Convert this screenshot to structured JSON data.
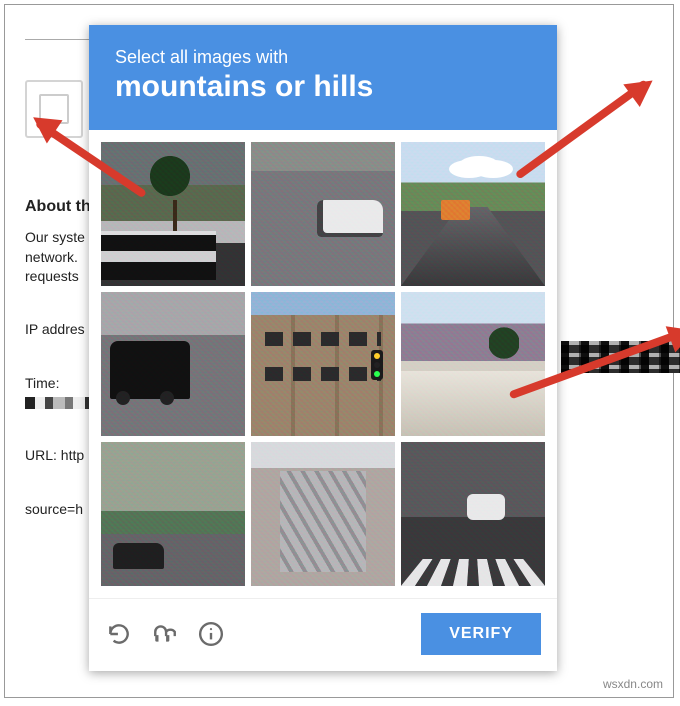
{
  "page": {
    "about_heading": "About th",
    "para1": "Our syste\nnetwork.\nrequests",
    "ip_label": "IP addres",
    "time_label": "Time:",
    "url_label": "URL: http",
    "source_label": "source=h"
  },
  "captcha": {
    "prompt_line1": "Select all images with",
    "prompt_target": "mountains or hills",
    "verify_label": "VERIFY",
    "tiles": [
      {
        "id": 1,
        "desc": "palm tree hills truck"
      },
      {
        "id": 2,
        "desc": "white car on road"
      },
      {
        "id": 3,
        "desc": "highway with hills and trucks"
      },
      {
        "id": 4,
        "desc": "black SUV parking lot"
      },
      {
        "id": 5,
        "desc": "brick building traffic light"
      },
      {
        "id": 6,
        "desc": "mountains palm awning"
      },
      {
        "id": 7,
        "desc": "car on rural road trees"
      },
      {
        "id": 8,
        "desc": "fire escape building"
      },
      {
        "id": 9,
        "desc": "street crosswalk car"
      }
    ]
  },
  "watermark": "wsxdn.com"
}
